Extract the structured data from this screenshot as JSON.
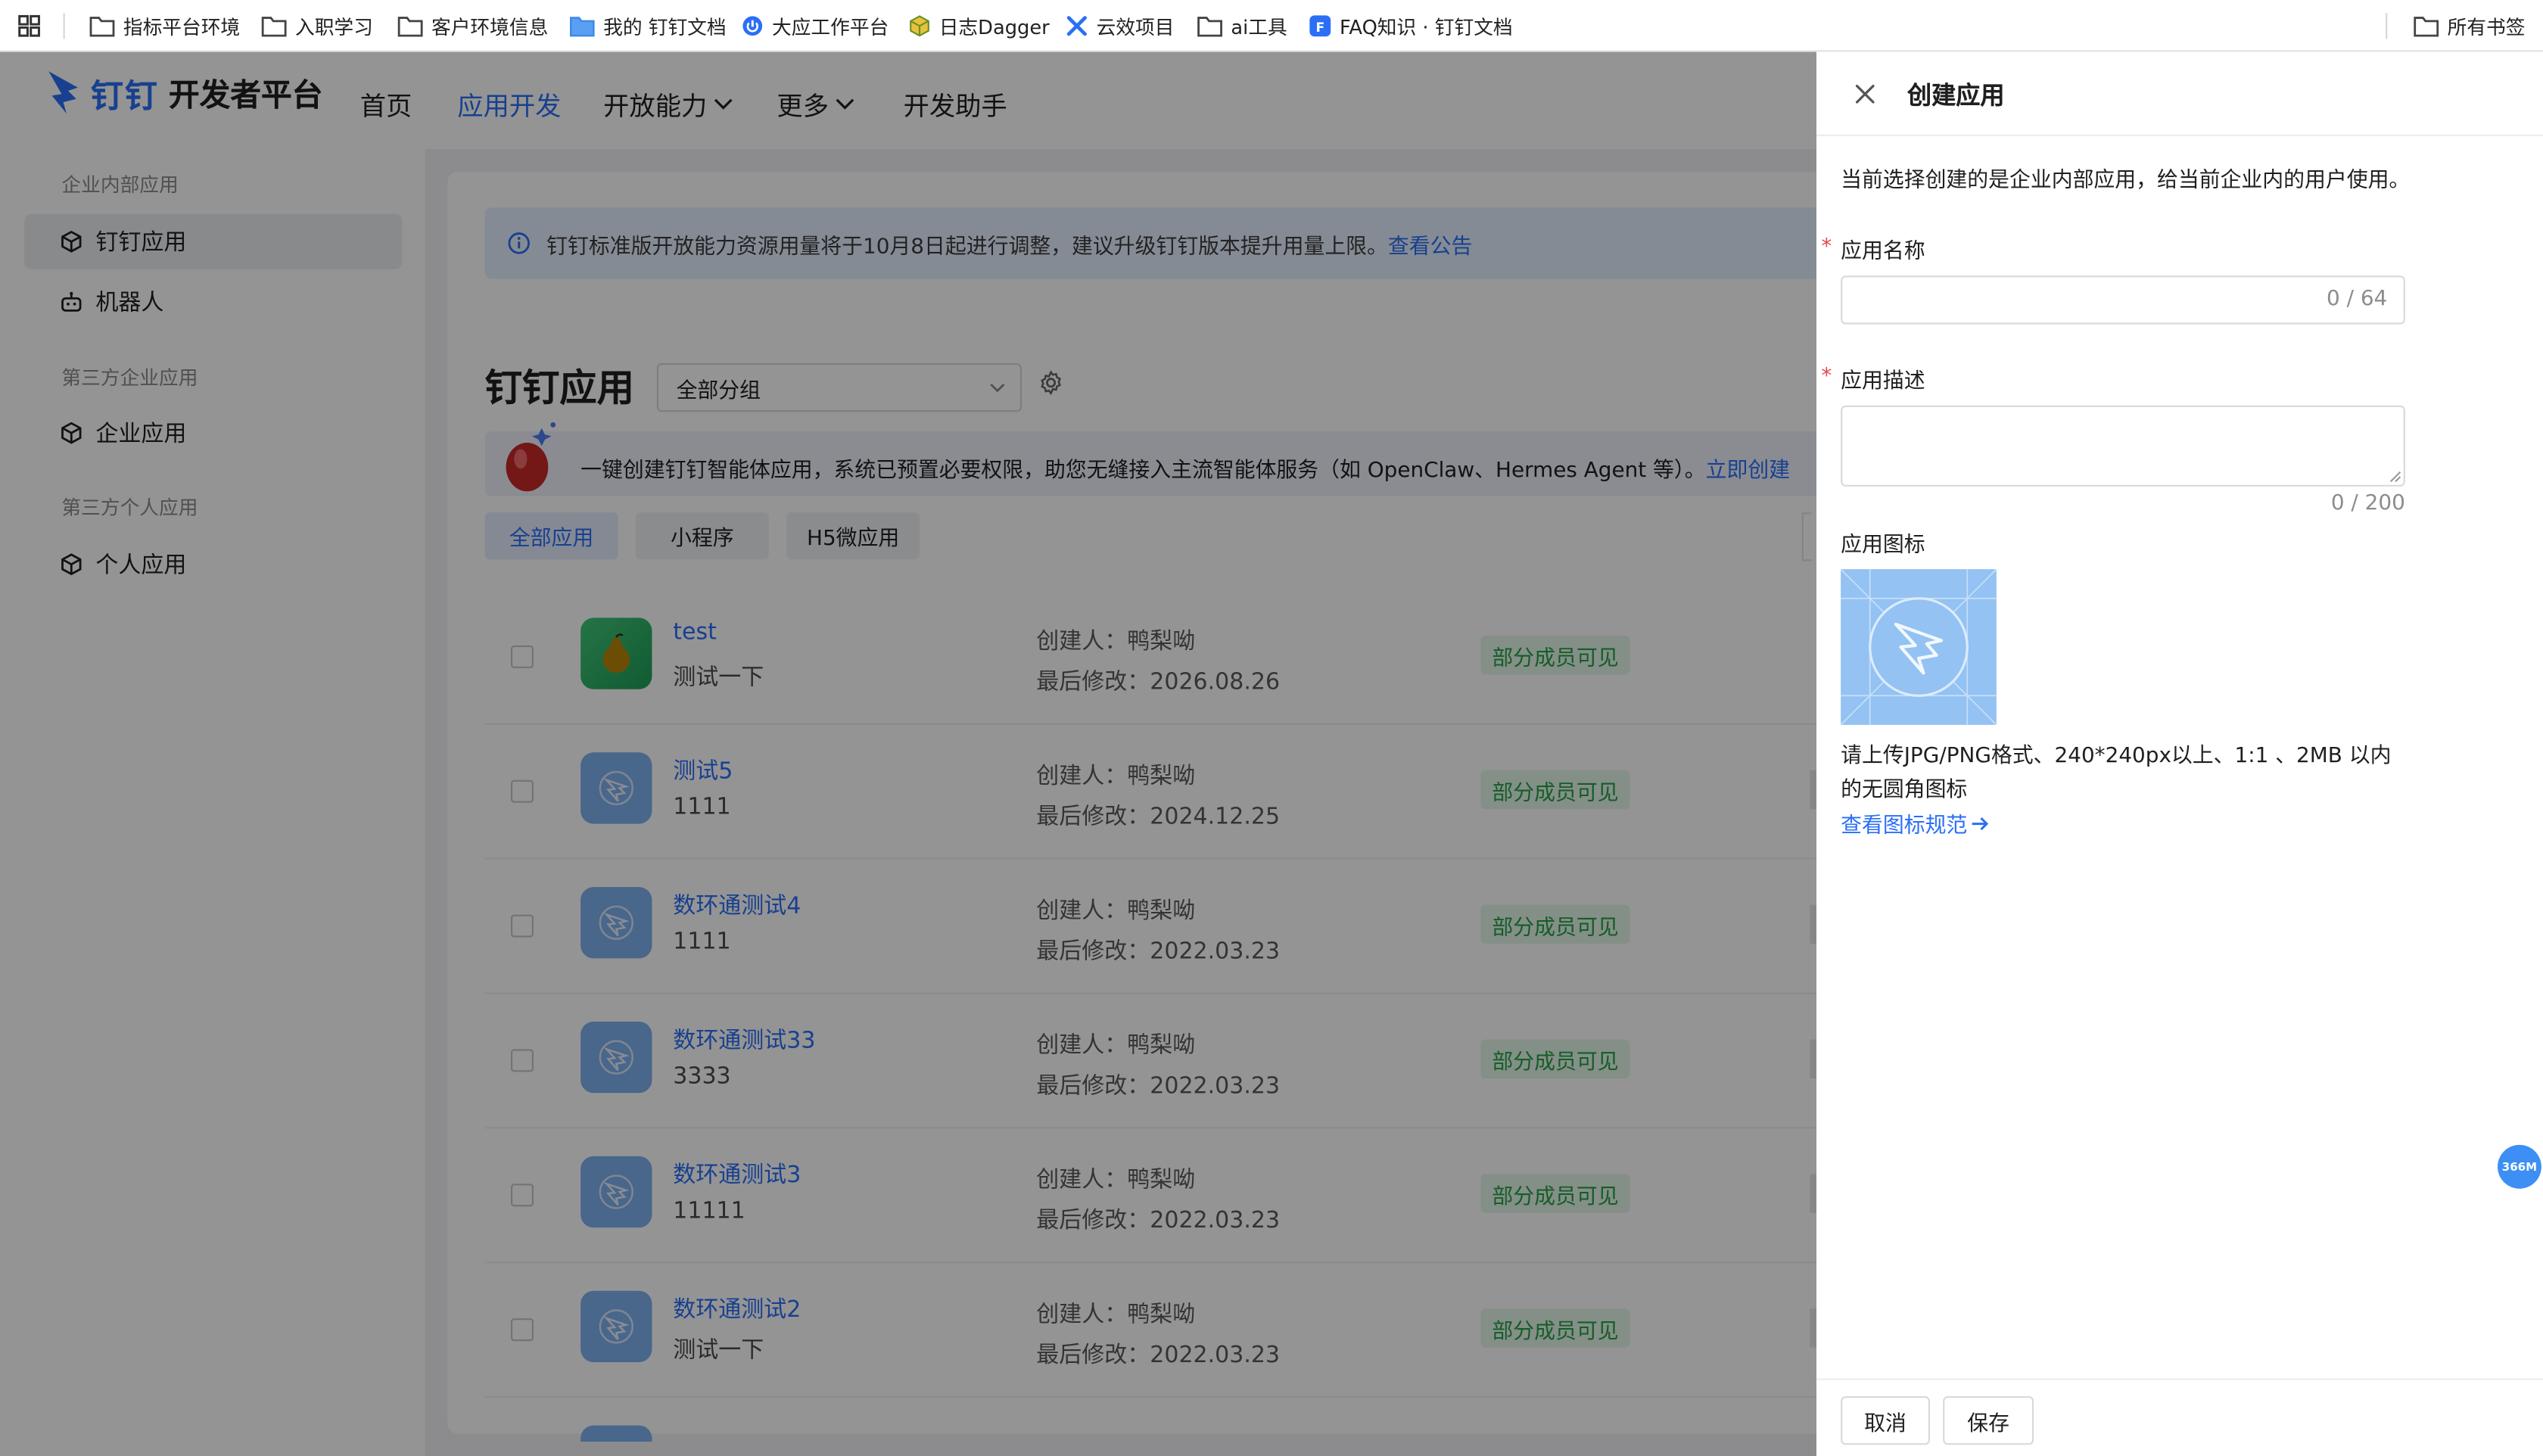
{
  "bookmarks": {
    "items": [
      {
        "label": "指标平台环境",
        "icon": "folder-icon"
      },
      {
        "label": "入职学习",
        "icon": "folder-icon"
      },
      {
        "label": "客户环境信息",
        "icon": "folder-icon"
      },
      {
        "label": "我的 钉钉文档",
        "icon": "folder-icon"
      },
      {
        "label": "大应工作平台",
        "icon": "power-icon"
      },
      {
        "label": "日志Dagger",
        "icon": "cube-icon"
      },
      {
        "label": "云效项目",
        "icon": "x-logo-icon"
      },
      {
        "label": "ai工具",
        "icon": "folder-icon"
      },
      {
        "label": "FAQ知识 · 钉钉文档",
        "icon": "doc-f-icon"
      }
    ],
    "all_bookmarks": "所有书签"
  },
  "header": {
    "logo_text": "钉钉",
    "logo_sub": "开发者平台",
    "nav": [
      {
        "label": "首页",
        "active": false
      },
      {
        "label": "应用开发",
        "active": true
      },
      {
        "label": "开放能力",
        "dropdown": true
      },
      {
        "label": "更多",
        "dropdown": true
      },
      {
        "label": "开发助手"
      }
    ]
  },
  "sidebar": {
    "groups": [
      {
        "title": "企业内部应用",
        "items": [
          {
            "label": "钉钉应用",
            "selected": true
          },
          {
            "label": "机器人"
          }
        ]
      },
      {
        "title": "第三方企业应用",
        "items": [
          {
            "label": "企业应用"
          }
        ]
      },
      {
        "title": "第三方个人应用",
        "items": [
          {
            "label": "个人应用"
          }
        ]
      }
    ]
  },
  "main": {
    "notice_text": "钉钉标准版开放能力资源用量将于10月8日起进行调整，建议升级钉钉版本提升用量上限。",
    "notice_link": "查看公告",
    "title": "钉钉应用",
    "group_select": "全部分组",
    "ai_banner_text": "一键创建钉钉智能体应用，系统已预置必要权限，助您无缝接入主流智能体服务（如 OpenClaw、Hermes Agent 等）。",
    "ai_banner_link": "立即创建",
    "tabs": [
      "全部应用",
      "小程序",
      "H5微应用"
    ],
    "creator_label": "创建人：",
    "modified_label": "最后修改：",
    "apps": [
      {
        "name": "test",
        "desc": "测试一下",
        "creator": "鸭梨呦",
        "modified": "2026.08.26",
        "visibility": "部分成员可见",
        "icon": "pear-icon"
      },
      {
        "name": "测试5",
        "desc": "1111",
        "creator": "鸭梨呦",
        "modified": "2024.12.25",
        "visibility": "部分成员可见",
        "icon": "dingtalk-app-icon"
      },
      {
        "name": "数环通测试4",
        "desc": "1111",
        "creator": "鸭梨呦",
        "modified": "2022.03.23",
        "visibility": "部分成员可见",
        "icon": "dingtalk-app-icon"
      },
      {
        "name": "数环通测试33",
        "desc": "3333",
        "creator": "鸭梨呦",
        "modified": "2022.03.23",
        "visibility": "部分成员可见",
        "icon": "dingtalk-app-icon"
      },
      {
        "name": "数环通测试3",
        "desc": "11111",
        "creator": "鸭梨呦",
        "modified": "2022.03.23",
        "visibility": "部分成员可见",
        "icon": "dingtalk-app-icon"
      },
      {
        "name": "数环通测试2",
        "desc": "测试一下",
        "creator": "鸭梨呦",
        "modified": "2022.03.23",
        "visibility": "部分成员可见",
        "icon": "dingtalk-app-icon"
      }
    ]
  },
  "drawer": {
    "title": "创建应用",
    "intro": "当前选择创建的是企业内部应用，给当前企业内的用户使用。",
    "name_label": "应用名称",
    "name_value": "",
    "name_count": "0 / 64",
    "desc_label": "应用描述",
    "desc_value": "",
    "desc_count": "0 / 200",
    "icon_label": "应用图标",
    "icon_hint": "请上传JPG/PNG格式、240*240px以上、1:1 、2MB 以内的无圆角图标",
    "icon_link": "查看图标规范",
    "cancel": "取消",
    "save": "保存"
  },
  "memory_badge": "366M",
  "colors": {
    "accent": "#2a6ff6",
    "success": "#23a046",
    "required": "#e5484d"
  }
}
